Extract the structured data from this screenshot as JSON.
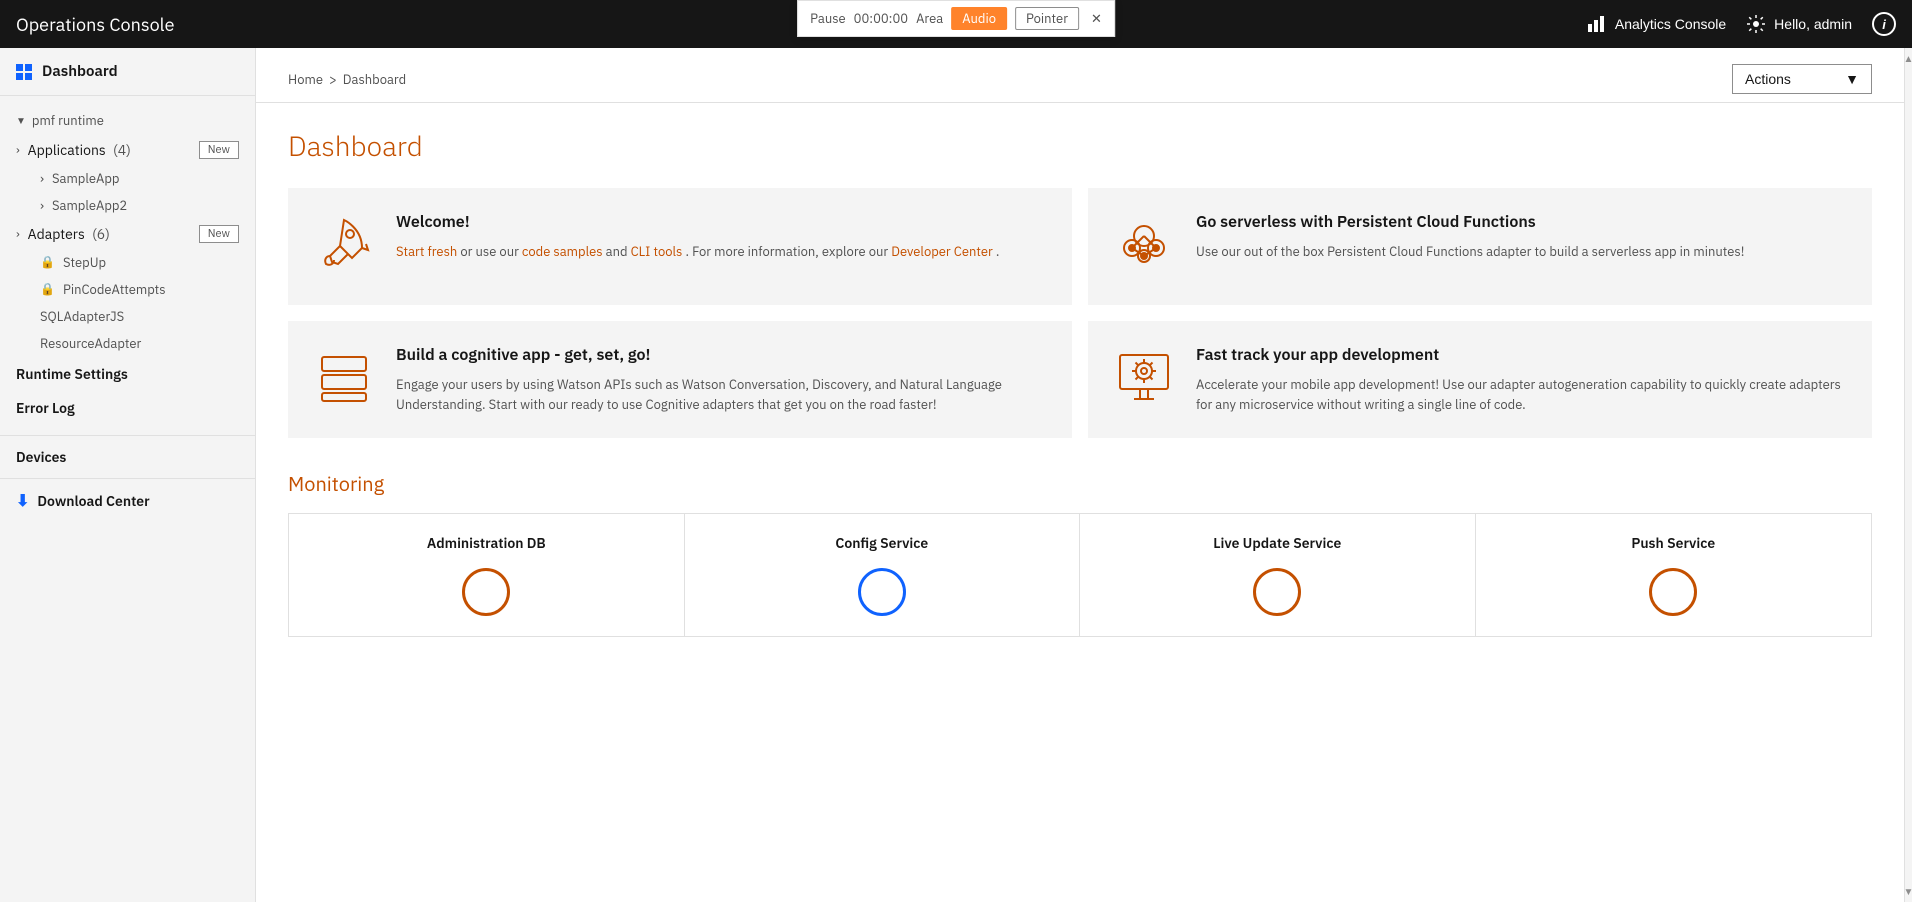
{
  "topbar": {
    "title": "Operations Console",
    "analytics_label": "Analytics Console",
    "hello_label": "Hello, admin",
    "info_icon": "ℹ"
  },
  "overlay": {
    "pause_label": "Pause",
    "time_label": "00:00:00",
    "area_label": "Area",
    "audio_label": "Audio",
    "pointer_label": "Pointer",
    "close_label": "✕"
  },
  "sidebar": {
    "dashboard_label": "Dashboard",
    "runtime_label": "pmf runtime",
    "applications_label": "Applications",
    "applications_count": "(4)",
    "applications_badge": "New",
    "app1": "SampleApp",
    "app2": "SampleApp2",
    "adapters_label": "Adapters",
    "adapters_count": "(6)",
    "adapters_badge": "New",
    "adapter1": "StepUp",
    "adapter2": "PinCodeAttempts",
    "adapter3": "SQLAdapterJS",
    "adapter4": "ResourceAdapter",
    "runtime_settings_label": "Runtime Settings",
    "error_log_label": "Error Log",
    "devices_label": "Devices",
    "download_center_label": "Download Center"
  },
  "breadcrumb": {
    "home": "Home",
    "separator": ">",
    "current": "Dashboard"
  },
  "actions_label": "Actions",
  "page_title": "Dashboard",
  "cards": [
    {
      "title": "Welcome!",
      "body_prefix": "Start fresh",
      "body_mid1": " or use our ",
      "body_link1": "code samples",
      "body_mid2": " and ",
      "body_link2": "CLI tools",
      "body_suffix1": ". For more information, explore our ",
      "body_link3": "Developer Center",
      "body_suffix2": "."
    },
    {
      "title": "Go serverless with Persistent Cloud Functions",
      "body": "Use our out of the box Persistent Cloud Functions adapter to build a serverless app in minutes!"
    },
    {
      "title": "Build a cognitive app - get, set, go!",
      "body": "Engage your users by using Watson APIs such as Watson Conversation, Discovery, and Natural Language Understanding. Start with our ready to use Cognitive adapters that get you on the road faster!"
    },
    {
      "title": "Fast track your app development",
      "body": "Accelerate your mobile app development! Use our adapter autogeneration capability to quickly create adapters for any microservice without writing a single line of code."
    }
  ],
  "monitoring": {
    "title": "Monitoring",
    "items": [
      {
        "label": "Administration DB"
      },
      {
        "label": "Config Service"
      },
      {
        "label": "Live Update Service"
      },
      {
        "label": "Push Service"
      }
    ]
  }
}
